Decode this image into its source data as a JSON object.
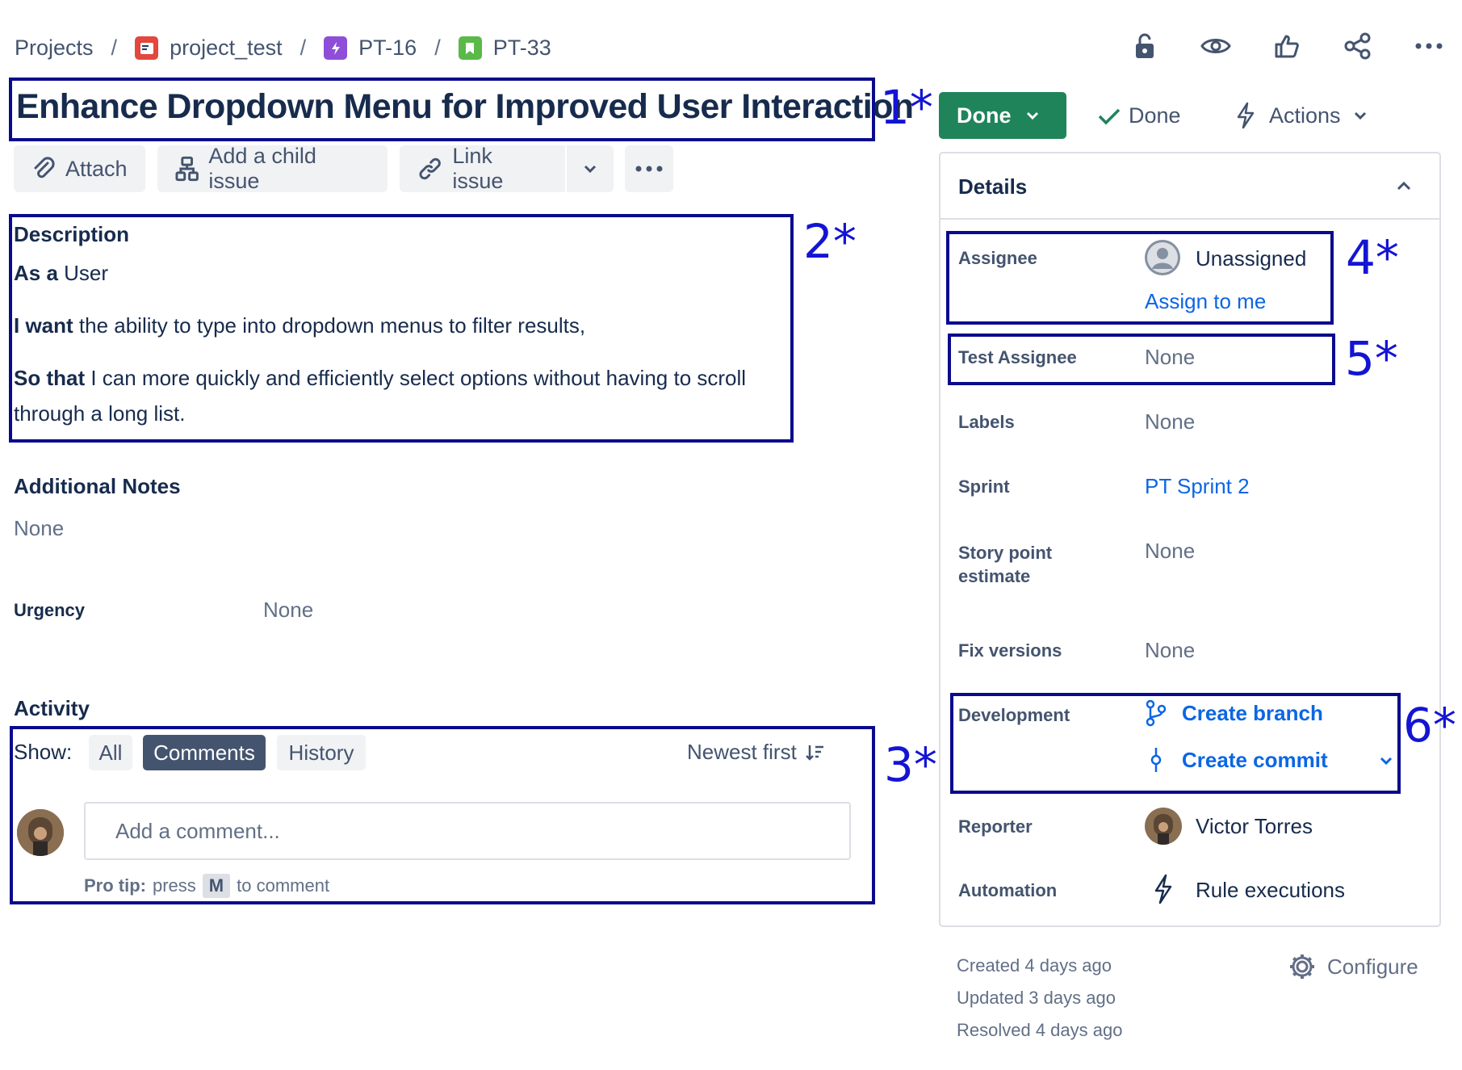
{
  "breadcrumb": {
    "projects": "Projects",
    "sep": "/",
    "project": "project_test",
    "epic": "PT-16",
    "issue": "PT-33"
  },
  "issue": {
    "title": "Enhance Dropdown Menu for Improved User Interaction"
  },
  "toolbar": {
    "attach": "Attach",
    "child": "Add a child issue",
    "link": "Link issue"
  },
  "description": {
    "heading": "Description",
    "as_a_label": "As a",
    "as_a_text": " User",
    "want_label": "I want",
    "want_text": " the ability to type into dropdown menus to filter results,",
    "so_label": "So that",
    "so_text": " I can more quickly and efficiently select options without having to scroll",
    "so_text_2": "through a long list."
  },
  "additional_notes": {
    "heading": "Additional Notes",
    "value": "None"
  },
  "urgency": {
    "label": "Urgency",
    "value": "None"
  },
  "activity": {
    "heading": "Activity",
    "show_label": "Show:",
    "filters": [
      "All",
      "Comments",
      "History"
    ],
    "active_filter": "Comments",
    "sort": "Newest first",
    "comment_placeholder": "Add a comment...",
    "tip_bold": "Pro tip:",
    "tip_press": "press",
    "tip_key": "M",
    "tip_end": "to comment"
  },
  "status": {
    "button": "Done",
    "resolution": "Done",
    "actions": "Actions"
  },
  "details": {
    "heading": "Details",
    "assignee_label": "Assignee",
    "assignee_value": "Unassigned",
    "assign_to_me": "Assign to me",
    "test_assignee_label": "Test Assignee",
    "test_assignee_value": "None",
    "labels_label": "Labels",
    "labels_value": "None",
    "sprint_label": "Sprint",
    "sprint_value": "PT Sprint 2",
    "story_label_1": "Story point",
    "story_label_2": "estimate",
    "story_value": "None",
    "fix_label": "Fix versions",
    "fix_value": "None",
    "dev_label": "Development",
    "create_branch": "Create branch",
    "create_commit": "Create commit",
    "reporter_label": "Reporter",
    "reporter_value": "Victor Torres",
    "automation_label": "Automation",
    "automation_value": "Rule executions"
  },
  "footer": {
    "created": "Created 4 days ago",
    "updated": "Updated 3 days ago",
    "resolved": "Resolved 4 days ago",
    "configure": "Configure"
  },
  "annotations": [
    "1*",
    "2*",
    "3*",
    "4*",
    "5*",
    "6*"
  ],
  "colors": {
    "done_green": "#1f845a",
    "link_blue": "#0c66e4",
    "annotation_box": "#0a0a8e",
    "annotation_text": "#1414d4"
  },
  "icons": [
    "lock-icon",
    "watch-icon",
    "like-icon",
    "share-icon",
    "more-icon",
    "attach-icon",
    "child-issue-icon",
    "link-icon",
    "branch-icon",
    "commit-icon",
    "lightning-icon",
    "gear-icon",
    "checkmark-icon"
  ]
}
